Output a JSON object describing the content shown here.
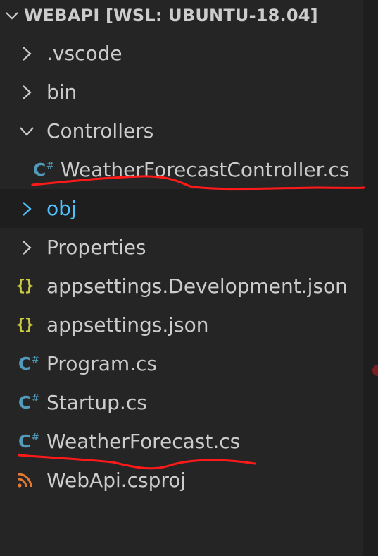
{
  "explorer": {
    "section_title": "WEBAPI [WSL: UBUNTU-18.04]",
    "items": [
      {
        "label": ".vscode",
        "type": "folder",
        "expanded": false
      },
      {
        "label": "bin",
        "type": "folder",
        "expanded": false
      },
      {
        "label": "Controllers",
        "type": "folder",
        "expanded": true
      },
      {
        "label": "WeatherForecastController.cs",
        "type": "csharp-file",
        "annotated": true
      },
      {
        "label": "obj",
        "type": "folder",
        "expanded": false,
        "highlighted": true
      },
      {
        "label": "Properties",
        "type": "folder",
        "expanded": false
      },
      {
        "label": "appsettings.Development.json",
        "type": "json-file"
      },
      {
        "label": "appsettings.json",
        "type": "json-file"
      },
      {
        "label": "Program.cs",
        "type": "csharp-file"
      },
      {
        "label": "Startup.cs",
        "type": "csharp-file"
      },
      {
        "label": "WeatherForecast.cs",
        "type": "csharp-file",
        "annotated": true
      },
      {
        "label": "WebApi.csproj",
        "type": "rss-project-file"
      }
    ]
  },
  "icons": {
    "chevron_collapsed": "chevron-right-icon",
    "chevron_expanded": "chevron-down-icon",
    "csharp": "csharp-file-icon",
    "json": "json-braces-icon",
    "project": "rss-feed-icon"
  },
  "colors": {
    "background": "#252526",
    "text": "#cccccc",
    "obj_highlight": "#4fc1ff",
    "csharp_icon": "#519aba",
    "json_icon": "#cbcb41",
    "rss_icon": "#e37933",
    "annotation": "#ff0000"
  }
}
